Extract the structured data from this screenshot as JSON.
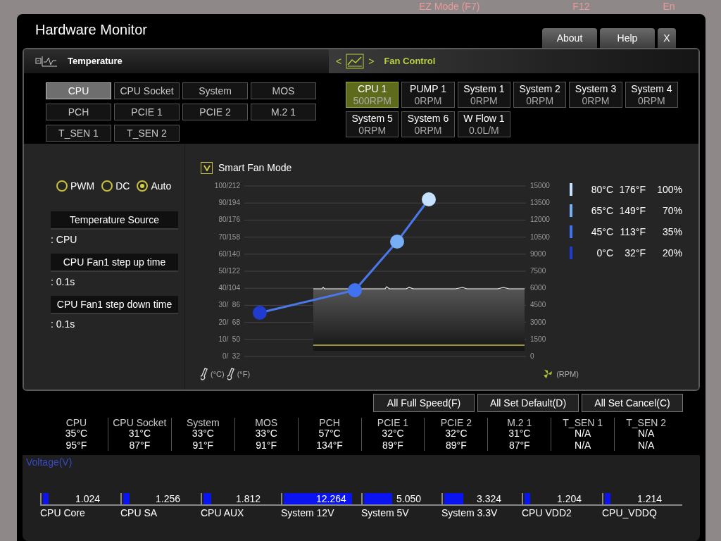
{
  "background": {
    "labels": [
      "EZ Mode (F7)",
      "F12",
      "En"
    ]
  },
  "window": {
    "title": "Hardware Monitor",
    "buttons": [
      "About",
      "Help",
      "X"
    ]
  },
  "temperature": {
    "title": "Temperature",
    "sensors": [
      {
        "label": "CPU",
        "selected": true
      },
      {
        "label": "CPU Socket",
        "selected": false
      },
      {
        "label": "System",
        "selected": false
      },
      {
        "label": "MOS",
        "selected": false
      },
      {
        "label": "PCH",
        "selected": false
      },
      {
        "label": "PCIE 1",
        "selected": false
      },
      {
        "label": "PCIE 2",
        "selected": false
      },
      {
        "label": "M.2 1",
        "selected": false
      },
      {
        "label": "T_SEN 1",
        "selected": false
      },
      {
        "label": "T_SEN 2",
        "selected": false
      }
    ]
  },
  "fan_control": {
    "title": "Fan Control",
    "prev": "<",
    "next": ">",
    "fans": [
      {
        "name": "CPU 1",
        "reading": "500RPM",
        "selected": true
      },
      {
        "name": "PUMP 1",
        "reading": "0RPM",
        "selected": false
      },
      {
        "name": "System 1",
        "reading": "0RPM",
        "selected": false
      },
      {
        "name": "System 2",
        "reading": "0RPM",
        "selected": false
      },
      {
        "name": "System 3",
        "reading": "0RPM",
        "selected": false
      },
      {
        "name": "System 4",
        "reading": "0RPM",
        "selected": false
      },
      {
        "name": "System 5",
        "reading": "0RPM",
        "selected": false
      },
      {
        "name": "System 6",
        "reading": "0RPM",
        "selected": false
      },
      {
        "name": "W Flow 1",
        "reading": "0.0L/M",
        "selected": false
      }
    ]
  },
  "fan_settings": {
    "modes": [
      {
        "label": "PWM",
        "selected": false
      },
      {
        "label": "DC",
        "selected": false
      },
      {
        "label": "Auto",
        "selected": true
      }
    ],
    "settings": [
      {
        "label": "Temperature Source",
        "value": ": CPU"
      },
      {
        "label": "CPU Fan1 step up time",
        "value": ": 0.1s"
      },
      {
        "label": "CPU Fan1 step down time",
        "value": ": 0.1s"
      }
    ]
  },
  "smart_fan": {
    "label": "Smart Fan Mode",
    "checked": true,
    "left_ticks": [
      "100/212",
      "90/194",
      "80/176",
      "70/158",
      "60/140",
      "50/122",
      "40/104",
      "30/  86",
      "20/  68",
      "10/  50",
      "0/  32"
    ],
    "right_ticks": [
      "15000",
      "13500",
      "12000",
      "10500",
      "9000",
      "7500",
      "6000",
      "4500",
      "3000",
      "1500",
      "0"
    ],
    "units": [
      "(°C)",
      "(°F)",
      "(RPM)"
    ],
    "points": [
      {
        "celsius": "80°C",
        "fahrenheit": "176°F",
        "duty": "100%",
        "color": "#c4e2ff"
      },
      {
        "celsius": "65°C",
        "fahrenheit": "149°F",
        "duty": "70%",
        "color": "#78aef5"
      },
      {
        "celsius": "45°C",
        "fahrenheit": "113°F",
        "duty": "35%",
        "color": "#3f73f0"
      },
      {
        "celsius": "0°C",
        "fahrenheit": "32°F",
        "duty": "20%",
        "color": "#1f3ccf"
      }
    ]
  },
  "actions": [
    "All Full Speed(F)",
    "All Set Default(D)",
    "All Set Cancel(C)"
  ],
  "readings": [
    {
      "name": "CPU",
      "celsius": "35°C",
      "fahrenheit": "95°F"
    },
    {
      "name": "CPU Socket",
      "celsius": "31°C",
      "fahrenheit": "87°F"
    },
    {
      "name": "System",
      "celsius": "33°C",
      "fahrenheit": "91°F"
    },
    {
      "name": "MOS",
      "celsius": "33°C",
      "fahrenheit": "91°F"
    },
    {
      "name": "PCH",
      "celsius": "57°C",
      "fahrenheit": "134°F"
    },
    {
      "name": "PCIE 1",
      "celsius": "32°C",
      "fahrenheit": "89°F"
    },
    {
      "name": "PCIE 2",
      "celsius": "32°C",
      "fahrenheit": "89°F"
    },
    {
      "name": "M.2 1",
      "celsius": "31°C",
      "fahrenheit": "87°F"
    },
    {
      "name": "T_SEN 1",
      "celsius": "N/A",
      "fahrenheit": "N/A"
    },
    {
      "name": "T_SEN 2",
      "celsius": "N/A",
      "fahrenheit": "N/A"
    }
  ],
  "voltage": {
    "title": "Voltage(V)",
    "rails": [
      {
        "name": "CPU Core",
        "value": "1.024",
        "level": 0.07
      },
      {
        "name": "CPU SA",
        "value": "1.256",
        "level": 0.08
      },
      {
        "name": "CPU AUX",
        "value": "1.812",
        "level": 0.1
      },
      {
        "name": "System 12V",
        "value": "12.264",
        "level": 0.87
      },
      {
        "name": "System 5V",
        "value": "5.050",
        "level": 0.36
      },
      {
        "name": "System 3.3V",
        "value": "3.324",
        "level": 0.24
      },
      {
        "name": "CPU VDD2",
        "value": "1.204",
        "level": 0.07
      },
      {
        "name": "CPU_VDDQ",
        "value": "1.214",
        "level": 0.07
      }
    ]
  }
}
